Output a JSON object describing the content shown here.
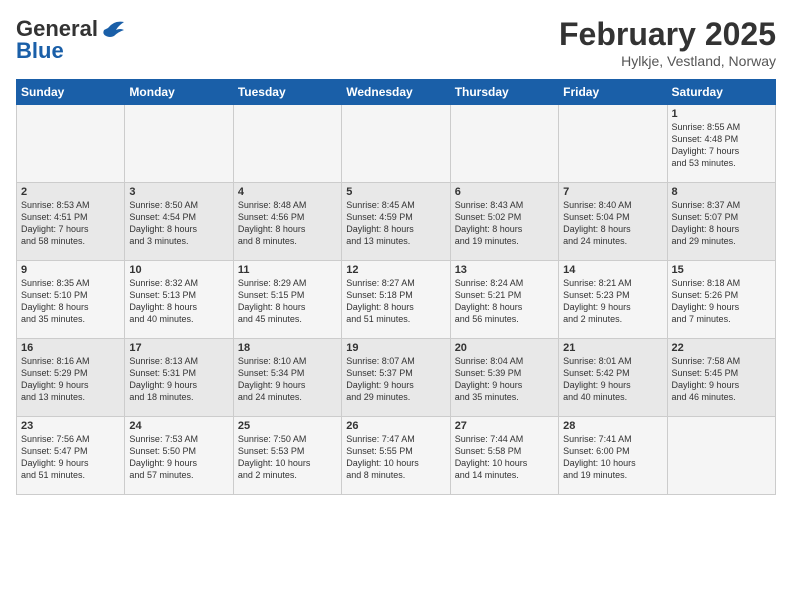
{
  "header": {
    "logo_line1": "General",
    "logo_line2": "Blue",
    "month": "February 2025",
    "location": "Hylkje, Vestland, Norway"
  },
  "days_of_week": [
    "Sunday",
    "Monday",
    "Tuesday",
    "Wednesday",
    "Thursday",
    "Friday",
    "Saturday"
  ],
  "weeks": [
    [
      {
        "day": "",
        "info": ""
      },
      {
        "day": "",
        "info": ""
      },
      {
        "day": "",
        "info": ""
      },
      {
        "day": "",
        "info": ""
      },
      {
        "day": "",
        "info": ""
      },
      {
        "day": "",
        "info": ""
      },
      {
        "day": "1",
        "info": "Sunrise: 8:55 AM\nSunset: 4:48 PM\nDaylight: 7 hours\nand 53 minutes."
      }
    ],
    [
      {
        "day": "2",
        "info": "Sunrise: 8:53 AM\nSunset: 4:51 PM\nDaylight: 7 hours\nand 58 minutes."
      },
      {
        "day": "3",
        "info": "Sunrise: 8:50 AM\nSunset: 4:54 PM\nDaylight: 8 hours\nand 3 minutes."
      },
      {
        "day": "4",
        "info": "Sunrise: 8:48 AM\nSunset: 4:56 PM\nDaylight: 8 hours\nand 8 minutes."
      },
      {
        "day": "5",
        "info": "Sunrise: 8:45 AM\nSunset: 4:59 PM\nDaylight: 8 hours\nand 13 minutes."
      },
      {
        "day": "6",
        "info": "Sunrise: 8:43 AM\nSunset: 5:02 PM\nDaylight: 8 hours\nand 19 minutes."
      },
      {
        "day": "7",
        "info": "Sunrise: 8:40 AM\nSunset: 5:04 PM\nDaylight: 8 hours\nand 24 minutes."
      },
      {
        "day": "8",
        "info": "Sunrise: 8:37 AM\nSunset: 5:07 PM\nDaylight: 8 hours\nand 29 minutes."
      }
    ],
    [
      {
        "day": "9",
        "info": "Sunrise: 8:35 AM\nSunset: 5:10 PM\nDaylight: 8 hours\nand 35 minutes."
      },
      {
        "day": "10",
        "info": "Sunrise: 8:32 AM\nSunset: 5:13 PM\nDaylight: 8 hours\nand 40 minutes."
      },
      {
        "day": "11",
        "info": "Sunrise: 8:29 AM\nSunset: 5:15 PM\nDaylight: 8 hours\nand 45 minutes."
      },
      {
        "day": "12",
        "info": "Sunrise: 8:27 AM\nSunset: 5:18 PM\nDaylight: 8 hours\nand 51 minutes."
      },
      {
        "day": "13",
        "info": "Sunrise: 8:24 AM\nSunset: 5:21 PM\nDaylight: 8 hours\nand 56 minutes."
      },
      {
        "day": "14",
        "info": "Sunrise: 8:21 AM\nSunset: 5:23 PM\nDaylight: 9 hours\nand 2 minutes."
      },
      {
        "day": "15",
        "info": "Sunrise: 8:18 AM\nSunset: 5:26 PM\nDaylight: 9 hours\nand 7 minutes."
      }
    ],
    [
      {
        "day": "16",
        "info": "Sunrise: 8:16 AM\nSunset: 5:29 PM\nDaylight: 9 hours\nand 13 minutes."
      },
      {
        "day": "17",
        "info": "Sunrise: 8:13 AM\nSunset: 5:31 PM\nDaylight: 9 hours\nand 18 minutes."
      },
      {
        "day": "18",
        "info": "Sunrise: 8:10 AM\nSunset: 5:34 PM\nDaylight: 9 hours\nand 24 minutes."
      },
      {
        "day": "19",
        "info": "Sunrise: 8:07 AM\nSunset: 5:37 PM\nDaylight: 9 hours\nand 29 minutes."
      },
      {
        "day": "20",
        "info": "Sunrise: 8:04 AM\nSunset: 5:39 PM\nDaylight: 9 hours\nand 35 minutes."
      },
      {
        "day": "21",
        "info": "Sunrise: 8:01 AM\nSunset: 5:42 PM\nDaylight: 9 hours\nand 40 minutes."
      },
      {
        "day": "22",
        "info": "Sunrise: 7:58 AM\nSunset: 5:45 PM\nDaylight: 9 hours\nand 46 minutes."
      }
    ],
    [
      {
        "day": "23",
        "info": "Sunrise: 7:56 AM\nSunset: 5:47 PM\nDaylight: 9 hours\nand 51 minutes."
      },
      {
        "day": "24",
        "info": "Sunrise: 7:53 AM\nSunset: 5:50 PM\nDaylight: 9 hours\nand 57 minutes."
      },
      {
        "day": "25",
        "info": "Sunrise: 7:50 AM\nSunset: 5:53 PM\nDaylight: 10 hours\nand 2 minutes."
      },
      {
        "day": "26",
        "info": "Sunrise: 7:47 AM\nSunset: 5:55 PM\nDaylight: 10 hours\nand 8 minutes."
      },
      {
        "day": "27",
        "info": "Sunrise: 7:44 AM\nSunset: 5:58 PM\nDaylight: 10 hours\nand 14 minutes."
      },
      {
        "day": "28",
        "info": "Sunrise: 7:41 AM\nSunset: 6:00 PM\nDaylight: 10 hours\nand 19 minutes."
      },
      {
        "day": "",
        "info": ""
      }
    ]
  ]
}
